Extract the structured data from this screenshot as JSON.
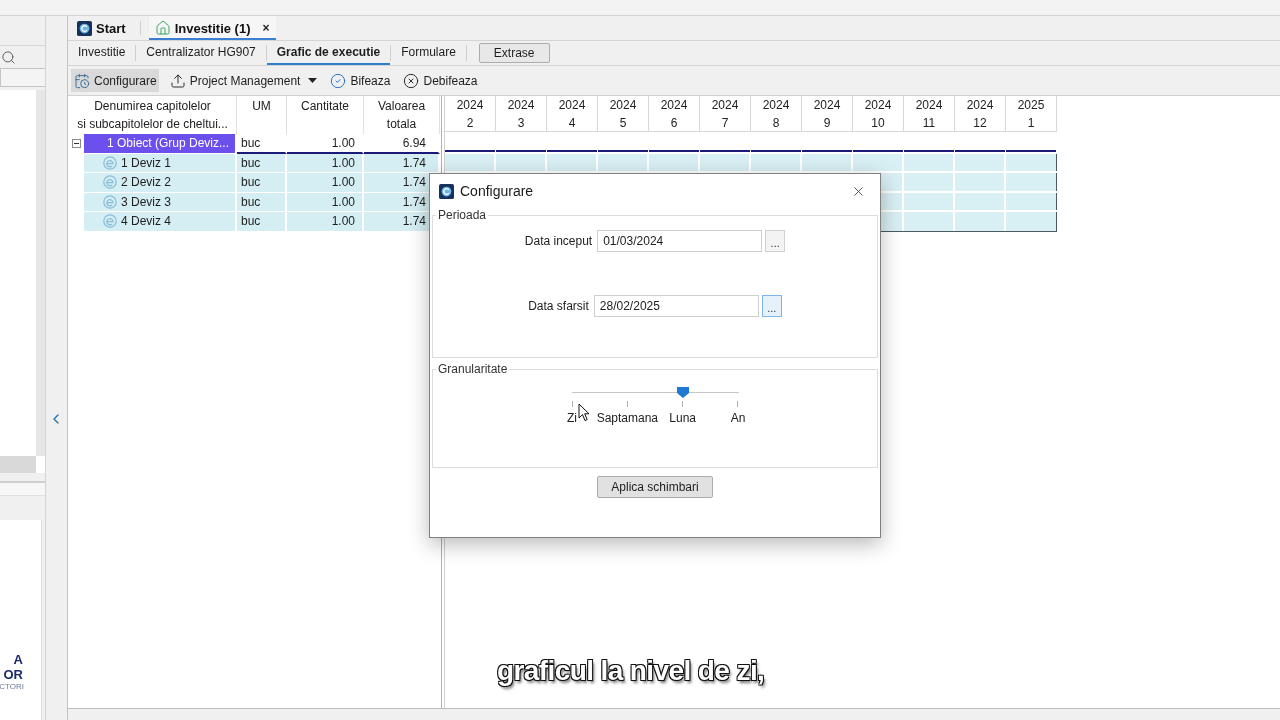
{
  "sidebar": {
    "logo_lines": [
      "A",
      "OR",
      "CTORI"
    ]
  },
  "document_tabs": [
    {
      "label": "Start",
      "kind": "app",
      "selected": false
    },
    {
      "label": "Investitie (1)",
      "kind": "document",
      "selected": true,
      "close": "×"
    }
  ],
  "sub_tabs": [
    {
      "label": "Investitie",
      "kind": "tab",
      "selected": false
    },
    {
      "label": "Centralizator HG907",
      "kind": "tab",
      "selected": false
    },
    {
      "label": "Grafic de executie",
      "kind": "tab",
      "selected": true
    },
    {
      "label": "Formulare",
      "kind": "tab",
      "selected": false
    },
    {
      "label": "Extrase",
      "kind": "button",
      "selected": false
    }
  ],
  "toolbar": [
    {
      "label": "Configurare",
      "kind": "calendar",
      "pressed": true
    },
    {
      "label": "Project Management",
      "kind": "menu",
      "pressed": false
    },
    {
      "label": "Bifeaza",
      "kind": "check",
      "pressed": false
    },
    {
      "label": "Debifeaza",
      "kind": "uncheck",
      "pressed": false
    }
  ],
  "table": {
    "columns": [
      {
        "lines": [
          "Denumirea capitolelor",
          "si subcapitolelor de cheltui..."
        ]
      },
      {
        "lines": [
          "UM"
        ]
      },
      {
        "lines": [
          "Cantitate"
        ]
      },
      {
        "lines": [
          "Valoarea",
          "totala"
        ]
      }
    ],
    "rows": [
      {
        "kind": "group",
        "name": "1 Obiect (Grup Deviz...",
        "um": "buc",
        "quantity": "1.00",
        "total": "6.94",
        "expanded": true,
        "selected": true,
        "children": [
          {
            "kind": "item",
            "name": "1 Deviz 1",
            "um": "buc",
            "quantity": "1.00",
            "total": "1.74",
            "selected": false
          },
          {
            "kind": "item",
            "name": "2 Deviz 2",
            "um": "buc",
            "quantity": "1.00",
            "total": "1.74",
            "selected": false
          },
          {
            "kind": "item",
            "name": "3 Deviz 3",
            "um": "buc",
            "quantity": "1.00",
            "total": "1.74",
            "selected": false
          },
          {
            "kind": "item",
            "name": "4 Deviz 4",
            "um": "buc",
            "quantity": "1.00",
            "total": "1.74",
            "selected": false
          }
        ]
      }
    ]
  },
  "gantt": {
    "periods": [
      {
        "year": "2024",
        "month": "2"
      },
      {
        "year": "2024",
        "month": "3"
      },
      {
        "year": "2024",
        "month": "4"
      },
      {
        "year": "2024",
        "month": "5"
      },
      {
        "year": "2024",
        "month": "6"
      },
      {
        "year": "2024",
        "month": "7"
      },
      {
        "year": "2024",
        "month": "8"
      },
      {
        "year": "2024",
        "month": "9"
      },
      {
        "year": "2024",
        "month": "10"
      },
      {
        "year": "2024",
        "month": "11"
      },
      {
        "year": "2024",
        "month": "12"
      },
      {
        "year": "2025",
        "month": "1"
      }
    ]
  },
  "dialog": {
    "title": "Configurare",
    "period": {
      "title": "Perioada",
      "fields": [
        {
          "label": "Data inceput",
          "value": "01/03/2024",
          "button": "...",
          "hovered": false
        },
        {
          "label": "Data sfarsit",
          "value": "28/02/2025",
          "button": "...",
          "hovered": true
        }
      ]
    },
    "granularity": {
      "title": "Granularitate",
      "ticks": [
        "Zi",
        "Saptamana",
        "Luna",
        "An"
      ],
      "level": 0.667
    },
    "apply": "Aplica schimbari"
  },
  "caption": "graficul la nivel de zi,"
}
